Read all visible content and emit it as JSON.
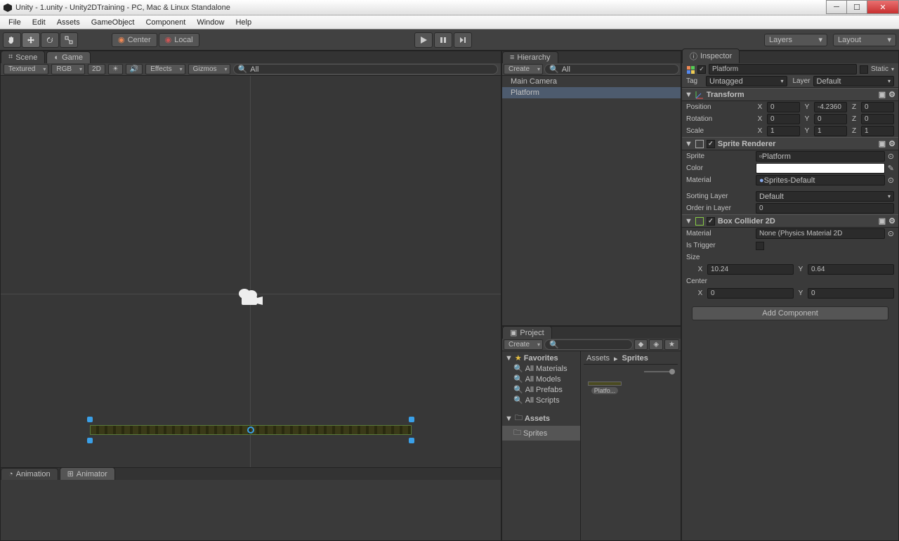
{
  "window": {
    "title": "Unity - 1.unity - Unity2DTraining - PC, Mac & Linux Standalone"
  },
  "menu": {
    "file": "File",
    "edit": "Edit",
    "assets": "Assets",
    "gameobject": "GameObject",
    "component": "Component",
    "window": "Window",
    "help": "Help"
  },
  "toolbar": {
    "center": "Center",
    "local": "Local",
    "layers": "Layers",
    "layout": "Layout"
  },
  "scene": {
    "tab_scene": "Scene",
    "tab_game": "Game",
    "shading": "Textured",
    "rgb": "RGB",
    "twod": "2D",
    "effects": "Effects",
    "gizmos": "Gizmos",
    "search_placeholder": "All"
  },
  "hierarchy": {
    "title": "Hierarchy",
    "create": "Create",
    "search_placeholder": "All",
    "items": [
      "Main Camera",
      "Platform"
    ],
    "selected": "Platform"
  },
  "project": {
    "title": "Project",
    "create": "Create",
    "favorites": "Favorites",
    "fav_items": [
      "All Materials",
      "All Models",
      "All Prefabs",
      "All Scripts"
    ],
    "assets": "Assets",
    "sprites": "Sprites",
    "breadcrumb": {
      "root": "Assets",
      "current": "Sprites"
    },
    "asset": "Platfo..."
  },
  "inspector": {
    "title": "Inspector",
    "object_name": "Platform",
    "static": "Static",
    "tag_label": "Tag",
    "tag_value": "Untagged",
    "layer_label": "Layer",
    "layer_value": "Default",
    "transform": {
      "title": "Transform",
      "position": "Position",
      "rotation": "Rotation",
      "scale": "Scale",
      "px": "0",
      "py": "-4.2360",
      "pz": "0",
      "rx": "0",
      "ry": "0",
      "rz": "0",
      "sx": "1",
      "sy": "1",
      "sz": "1"
    },
    "sprite_renderer": {
      "title": "Sprite Renderer",
      "sprite_label": "Sprite",
      "sprite_value": "Platform",
      "color_label": "Color",
      "material_label": "Material",
      "material_value": "Sprites-Default",
      "sorting_layer_label": "Sorting Layer",
      "sorting_layer_value": "Default",
      "order_label": "Order in Layer",
      "order_value": "0"
    },
    "box_collider": {
      "title": "Box Collider 2D",
      "material_label": "Material",
      "material_value": "None (Physics Material 2D",
      "trigger_label": "Is Trigger",
      "size_label": "Size",
      "size_x": "10.24",
      "size_y": "0.64",
      "center_label": "Center",
      "center_x": "0",
      "center_y": "0"
    },
    "add_component": "Add Component"
  },
  "bottom": {
    "animation": "Animation",
    "animator": "Animator"
  }
}
